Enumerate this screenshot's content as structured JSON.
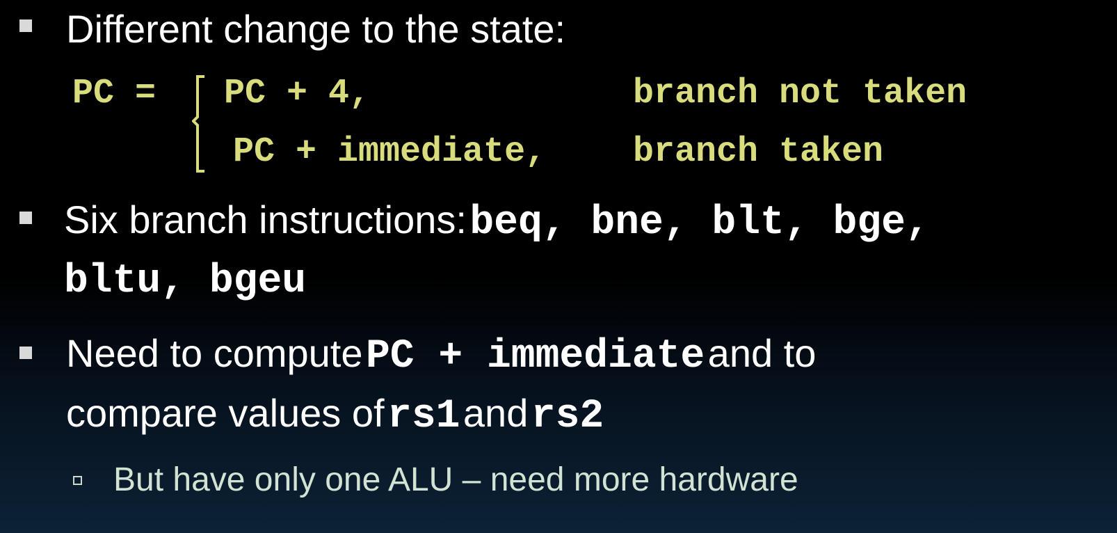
{
  "bullets": [
    {
      "text": "Different change to the state:"
    },
    {
      "prefix": "Six branch instructions:",
      "line1_code": "beq, bne, blt, bge,",
      "line2_code": "bltu, bgeu"
    },
    {
      "prefix": "Need to compute",
      "code1": "PC + immediate",
      "middle": "and to",
      "line2_prefix": "compare values of",
      "code2": "rs1",
      "and": "and",
      "code3": "rs2"
    }
  ],
  "equation": {
    "lhs": "PC =",
    "case1_expr": "PC + 4,",
    "case1_cond": "branch not taken",
    "case2_expr": "PC + immediate,",
    "case2_cond": "branch taken"
  },
  "sub_bullet": {
    "text": "But have only one ALU – need more hardware"
  },
  "colors": {
    "code_yellow": "#d8dc7c",
    "sub_text": "#d3e3d3",
    "bullet": "#d9d9d9"
  }
}
